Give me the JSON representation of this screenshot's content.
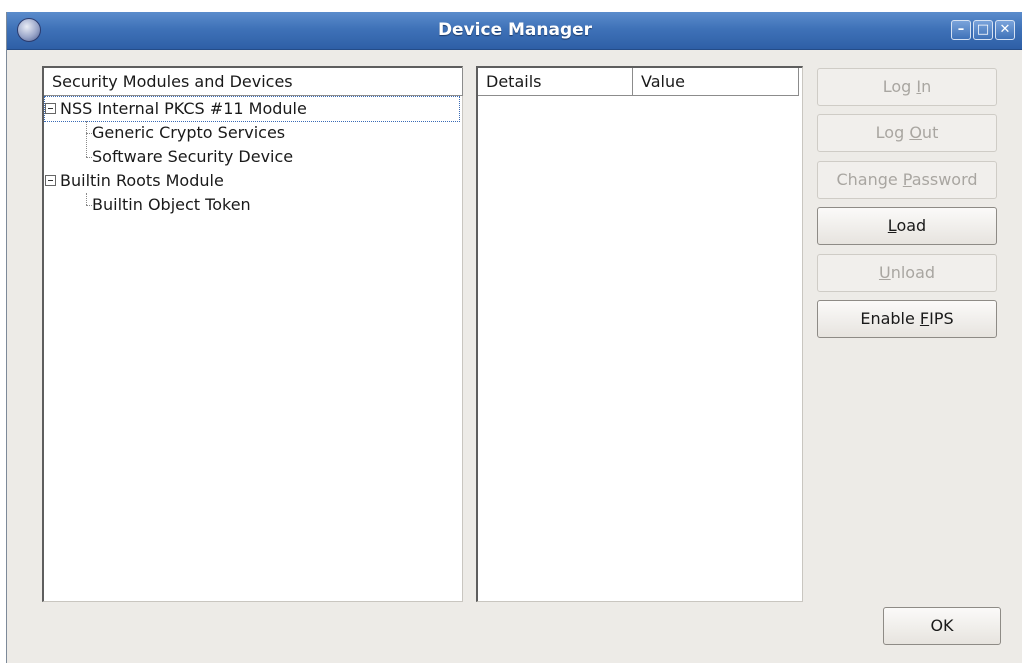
{
  "window": {
    "title": "Device Manager",
    "controls": {
      "minimize": "–",
      "maximize": "□",
      "close": "✕"
    }
  },
  "modules_panel": {
    "header": "Security Modules and Devices",
    "tree": [
      {
        "label": "NSS Internal PKCS #11 Module",
        "expanded": true,
        "focused": true,
        "children": [
          {
            "label": "Generic Crypto Services"
          },
          {
            "label": "Software Security Device"
          }
        ]
      },
      {
        "label": "Builtin Roots Module",
        "expanded": true,
        "children": [
          {
            "label": "Builtin Object Token"
          }
        ]
      }
    ]
  },
  "details_panel": {
    "columns": [
      "Details",
      "Value"
    ]
  },
  "buttons": {
    "login": {
      "pre": "Log ",
      "mn": "I",
      "post": "n",
      "enabled": false
    },
    "logout": {
      "pre": "Log ",
      "mn": "O",
      "post": "ut",
      "enabled": false
    },
    "change_password": {
      "pre": "Change ",
      "mn": "P",
      "post": "assword",
      "enabled": false
    },
    "load": {
      "pre": "",
      "mn": "L",
      "post": "oad",
      "enabled": true
    },
    "unload": {
      "pre": "",
      "mn": "U",
      "post": "nload",
      "enabled": false
    },
    "enable_fips": {
      "pre": "Enable ",
      "mn": "F",
      "post": "IPS",
      "enabled": true
    },
    "ok": "OK"
  },
  "colors": {
    "titlebar": "#3f72b8",
    "window_bg": "#edebe7"
  }
}
